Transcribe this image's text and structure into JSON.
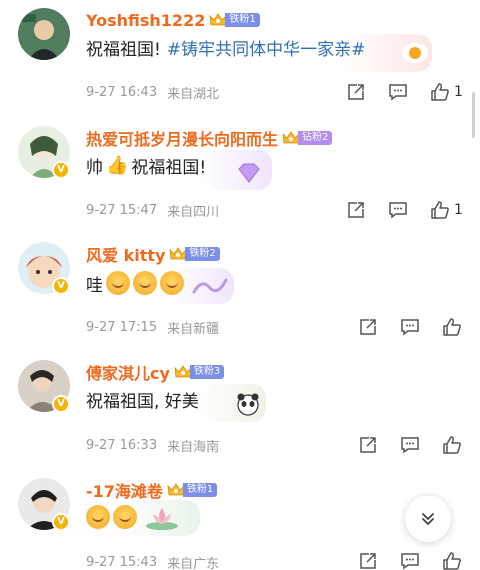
{
  "comments": [
    {
      "username": "Yoshfish1222",
      "fan_badge": "铁粉1",
      "text": "祝福祖国!",
      "hashtag": "#铸牢共同体中华一家亲#",
      "time": "9-27 16:43",
      "location": "来自湖北",
      "likes": "1",
      "fan_type": "tie"
    },
    {
      "username": "热爱可抵岁月漫长向阳而生",
      "fan_badge": "钻粉2",
      "text_prefix": "帅",
      "text": "祝福祖国!",
      "time": "9-27 15:47",
      "location": "来自四川",
      "likes": "1",
      "verified": true,
      "fan_type": "zuan"
    },
    {
      "username": "风爱 kitty",
      "fan_badge": "铁粉2",
      "text": "哇",
      "time": "9-27 17:15",
      "location": "来自新疆",
      "likes": "",
      "verified": true,
      "fan_type": "tie"
    },
    {
      "username": "傅家淇儿cy",
      "fan_badge": "铁粉3",
      "text": "祝福祖国, 好美",
      "time": "9-27 16:33",
      "location": "来自海南",
      "likes": "",
      "verified": true,
      "fan_type": "tie"
    },
    {
      "username": "-17海滩卷",
      "fan_badge": "铁粉1",
      "text": "",
      "time": "9-27 15:43",
      "location": "来自广东",
      "likes": "",
      "verified": true,
      "fan_type": "tie"
    }
  ],
  "icons": {
    "share": "share-icon",
    "comment": "comment-icon",
    "like": "like-icon",
    "scroll_down": "double-chevron-down-icon"
  },
  "colors": {
    "username": "#f06a1e",
    "hashtag": "#2f6fb5",
    "meta": "#999999",
    "verified": "#f5b400"
  }
}
